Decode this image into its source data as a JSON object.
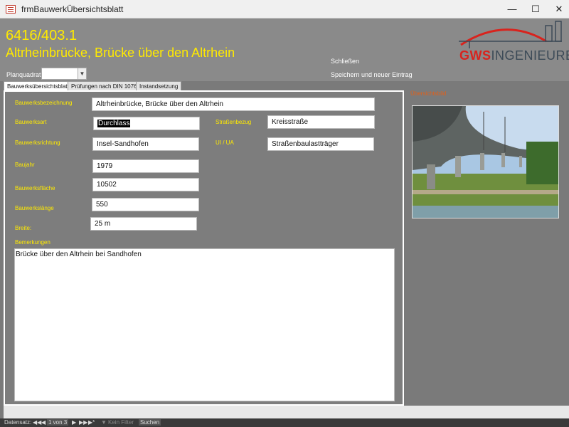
{
  "window": {
    "title": "frmBauwerkÜbersichtsblatt"
  },
  "header": {
    "number": "6416/403.1",
    "title": "Altrheinbrücke, Brücke über den Altrhein",
    "close_label": "Schließen",
    "save_new_label": "Speichern und neuer Eintrag",
    "planquadrat_label": "Planquadrat",
    "planquadrat_value": ""
  },
  "logo": {
    "part1": "GWS",
    "part2": "INGENIEURE",
    "accent_color": "#d9231d",
    "text_color": "#3c4a57"
  },
  "tabs": [
    {
      "label": "Bauwerksübersichtsblatt",
      "active": true
    },
    {
      "label": "Prüfungen nach DIN 1076",
      "active": false
    },
    {
      "label": "Instandsetzung",
      "active": false
    }
  ],
  "form": {
    "bezeichnung": {
      "label": "Bauwerksbezeichnung",
      "value": "Altrheinbrücke, Brücke über den Altrhein"
    },
    "art": {
      "label": "Bauwerksart",
      "value": "Durchlass"
    },
    "strassenbezug": {
      "label": "Straßenbezug",
      "value": "Kreisstraße"
    },
    "richtung": {
      "label": "Bauwerksrichtung",
      "value": "Insel-Sandhofen"
    },
    "ui_ua": {
      "label": "UI / UA",
      "value": "Straßenbaulastträger"
    },
    "baujahr": {
      "label": "Baujahr",
      "value": "1979"
    },
    "flaeche": {
      "label": "Bauwerksfläche",
      "value": "10502"
    },
    "laenge": {
      "label": "Bauwerkslänge",
      "value": "550"
    },
    "breite": {
      "label": "Breite:",
      "value": "25 m"
    },
    "bemerkungen": {
      "label": "Bemerkungen",
      "value": "Brücke über den Altrhein bei Sandhofen"
    }
  },
  "overview": {
    "label": "Übersichtsbild"
  },
  "statusbar": {
    "record_label": "Datensatz:",
    "record_value": "1 von 3",
    "filter_label": "Kein Filter",
    "search_label": "Suchen"
  },
  "colors": {
    "label_yellow": "#ffea00",
    "panel_gray": "#7d7d7d",
    "overview_orange": "#e0601a"
  }
}
